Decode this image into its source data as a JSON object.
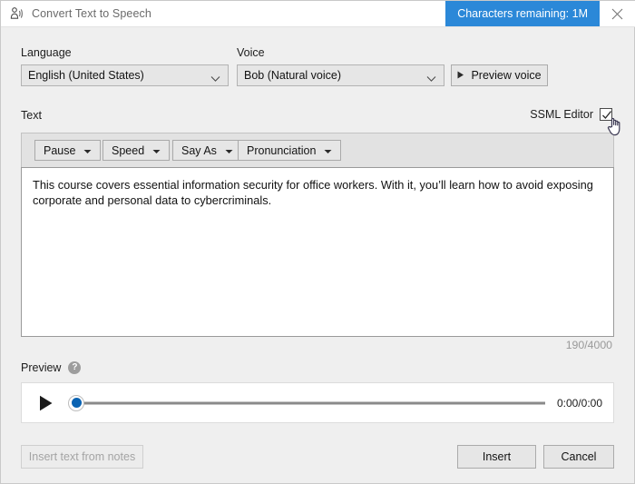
{
  "window": {
    "title": "Convert Text to Speech",
    "icon": "text-to-speech-icon",
    "chars_badge": "Characters remaining: 1M",
    "close_icon": "close-icon"
  },
  "language": {
    "label": "Language",
    "value": "English (United States)"
  },
  "voice": {
    "label": "Voice",
    "value": "Bob (Natural voice)",
    "preview_button": "Preview voice"
  },
  "text_section": {
    "label": "Text",
    "ssml_label": "SSML Editor",
    "ssml_checked": true,
    "toolbar": [
      {
        "label": "Pause"
      },
      {
        "label": "Speed"
      },
      {
        "label": "Say As"
      },
      {
        "label": "Pronunciation"
      }
    ],
    "content": "This course covers essential information security for office workers. With it, you’ll learn how to avoid exposing corporate and personal data to cybercriminals.",
    "char_count": "190/4000"
  },
  "preview": {
    "label": "Preview",
    "help_icon": "?",
    "time": "0:00/0:00",
    "progress_percent": 0
  },
  "footer": {
    "insert_from_notes": "Insert text from notes",
    "insert": "Insert",
    "cancel": "Cancel"
  },
  "colors": {
    "accent_blue": "#2b88d8",
    "thumb_blue": "#0a63b3",
    "dialog_bg": "#efefef"
  }
}
